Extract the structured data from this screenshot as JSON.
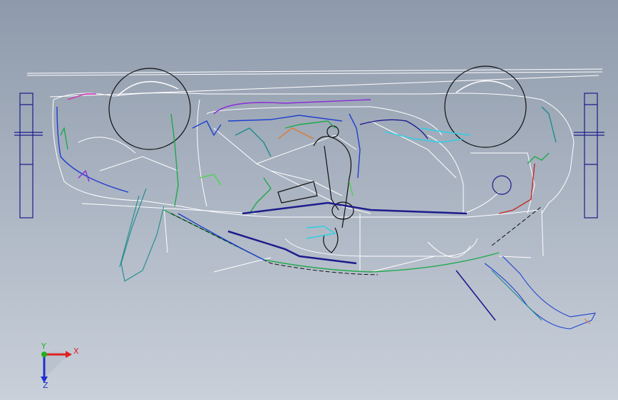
{
  "viewport": {
    "background_top": "#8e9aab",
    "background_bottom": "#c9d0da",
    "wire_colors": {
      "white": "#ffffff",
      "black": "#111111",
      "navy": "#1c1c8c",
      "blue": "#1f3fd0",
      "cyan": "#2bd0e6",
      "teal": "#1e8c8c",
      "green": "#1fa84a",
      "lime": "#49d649",
      "purple": "#8a2bd6",
      "magenta": "#d62bb8",
      "orange": "#e07a2b",
      "red": "#c82828"
    }
  },
  "triad": {
    "x_label": "X",
    "y_label": "Y",
    "z_label": "Z",
    "x_color": "#e02020",
    "y_color": "#20b020",
    "z_color": "#2030d0"
  }
}
